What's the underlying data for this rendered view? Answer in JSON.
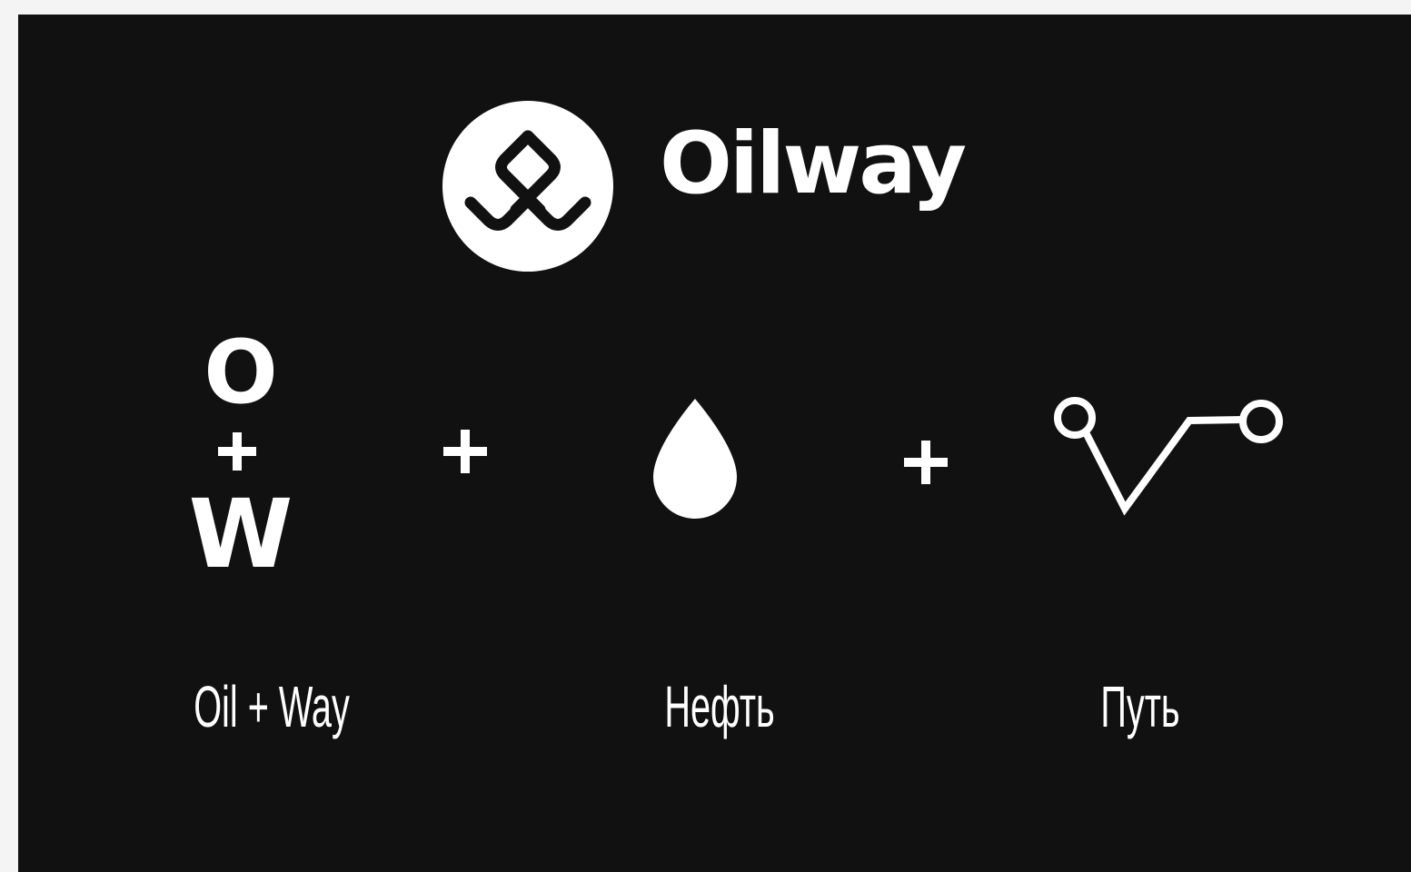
{
  "brand": {
    "name": "Oilway",
    "logo_icon": "oil-drop-wave-icon"
  },
  "formula": {
    "letter_o": "O",
    "letter_w": "W",
    "plus_sign": "+",
    "icons": [
      "plus-icon",
      "oil-drop-icon",
      "plus-icon",
      "route-path-icon"
    ]
  },
  "captions": [
    "Oil + Way",
    "Нефть",
    "Путь"
  ],
  "colors": {
    "background": "#111111",
    "foreground": "#ffffff",
    "page": "#f4f4f4"
  }
}
